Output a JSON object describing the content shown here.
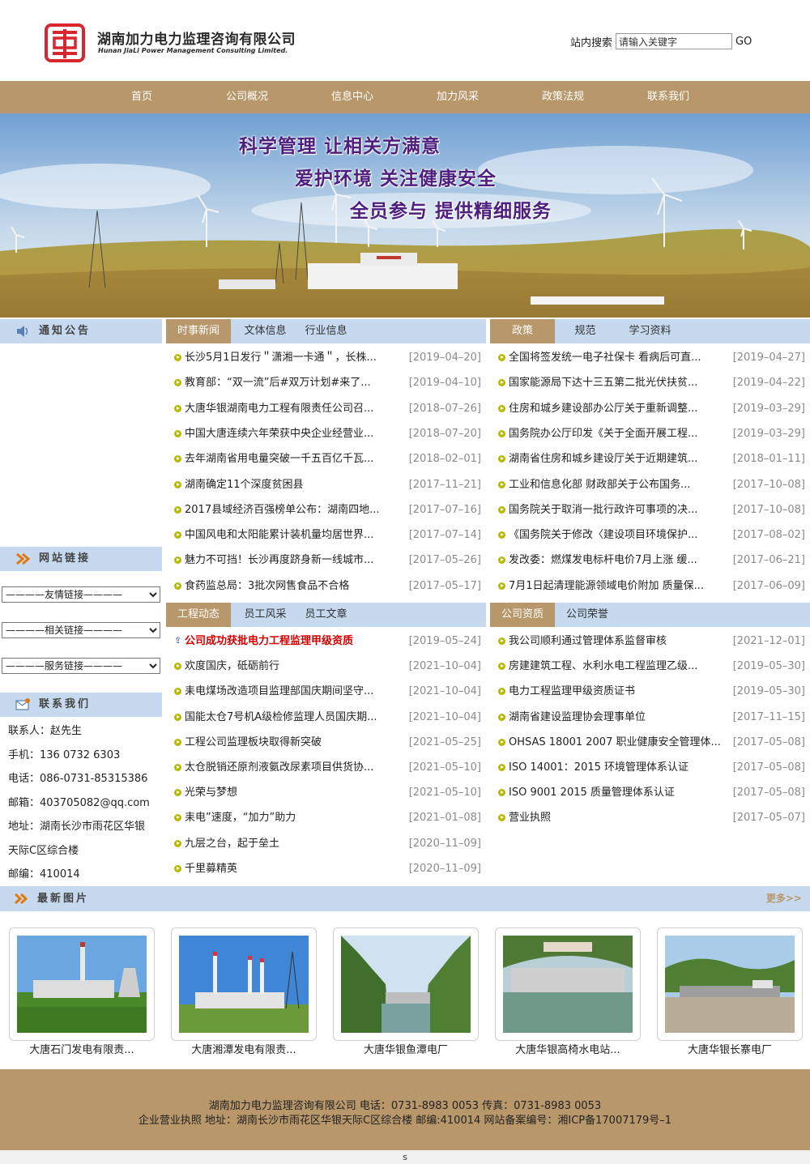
{
  "header": {
    "logo_cn": "湖南加力电力监理咨询有限公司",
    "logo_en": "Hunan JiaLi Power Management Consulting Limited.",
    "search_label": "站内搜索",
    "search_placeholder": "请输入关键字",
    "search_button": "GO"
  },
  "nav": [
    "首页",
    "公司概况",
    "信息中心",
    "加力风采",
    "政策法规",
    "联系我们"
  ],
  "banner": {
    "slogan1": "科学管理  让相关方满意",
    "slogan2": "爱护环境  关注健康安全",
    "slogan3": "全员参与  提供精细服务"
  },
  "sidebar": {
    "notice_title": "通知公告",
    "links_title": "网站链接",
    "select_friend": "————友情链接————",
    "select_related": "————相关链接————",
    "select_service": "————服务链接————",
    "contact_title": "联系我们",
    "contact": [
      "联系人：赵先生",
      "手机：136 0732 6303",
      "电话：086-0731-85315386",
      "邮箱：403705082@qq.com",
      "地址：湖南长沙市雨花区华银",
      "天际C区综合楼",
      "邮编：410014"
    ]
  },
  "news": {
    "tabs": [
      "时事新闻",
      "文体信息",
      "行业信息"
    ],
    "items": [
      {
        "title": "长沙5月1日发行＂潇湘一卡通＂，长株...",
        "date": "[2019–04–20]"
      },
      {
        "title": "教育部：“双一流”后#双万计划#来了...",
        "date": "[2019–04–10]"
      },
      {
        "title": "大唐华银湖南电力工程有限责任公司召...",
        "date": "[2018–07–26]"
      },
      {
        "title": "中国大唐连续六年荣获中央企业经营业...",
        "date": "[2018–07–20]"
      },
      {
        "title": "去年湖南省用电量突破一千五百亿千瓦...",
        "date": "[2018–02–01]"
      },
      {
        "title": "湖南确定11个深度贫困县",
        "date": "[2017–11–21]"
      },
      {
        "title": "2017县域经济百强榜单公布：湖南四地...",
        "date": "[2017–07–16]"
      },
      {
        "title": "中国风电和太阳能累计装机量均居世界...",
        "date": "[2017–07–14]"
      },
      {
        "title": "魅力不可挡！长沙再度跻身新一线城市...",
        "date": "[2017–05–26]"
      },
      {
        "title": "食药监总局：3批次网售食品不合格",
        "date": "[2017–05–17]"
      }
    ]
  },
  "policy": {
    "tabs": [
      "政策",
      "规范",
      "学习资料"
    ],
    "items": [
      {
        "title": "全国将签发统一电子社保卡 看病后可直...",
        "date": "[2019–04–27]"
      },
      {
        "title": "国家能源局下达十三五第二批光伏扶贫...",
        "date": "[2019–04–22]"
      },
      {
        "title": "住房和城乡建设部办公厅关于重新调整...",
        "date": "[2019–03–29]"
      },
      {
        "title": "国务院办公厅印发《关于全面开展工程...",
        "date": "[2019–03–29]"
      },
      {
        "title": "湖南省住房和城乡建设厅关于近期建筑...",
        "date": "[2018–01–11]"
      },
      {
        "title": "工业和信息化部  财政部关于公布国务...",
        "date": "[2017–10–08]"
      },
      {
        "title": "国务院关于取消一批行政许可事项的决...",
        "date": "[2017–10–08]"
      },
      {
        "title": "《国务院关于修改〈建设项目环境保护...",
        "date": "[2017–08–02]"
      },
      {
        "title": "发改委：燃煤发电标杆电价7月上涨 缓...",
        "date": "[2017–06–21]"
      },
      {
        "title": "7月1日起清理能源领域电价附加 质量保...",
        "date": "[2017–06–09]"
      }
    ]
  },
  "projects": {
    "tabs": [
      "工程动态",
      "员工风采",
      "员工文章"
    ],
    "items": [
      {
        "title": "公司成功获批电力工程监理甲级资质",
        "date": "[2019–05–24]"
      },
      {
        "title": "欢度国庆，砥砺前行",
        "date": "[2021–10–04]"
      },
      {
        "title": "耒电煤场改造项目监理部国庆期间坚守...",
        "date": "[2021–10–04]"
      },
      {
        "title": "国能太仓7号机A级检修监理人员国庆期...",
        "date": "[2021–10–04]"
      },
      {
        "title": "工程公司监理板块取得新突破",
        "date": "[2021–05–25]"
      },
      {
        "title": "太仓脱销还原剂液氨改尿素项目供货协...",
        "date": "[2021–05–10]"
      },
      {
        "title": "光荣与梦想",
        "date": "[2021–05–10]"
      },
      {
        "title": "耒电”速度，“加力”助力",
        "date": "[2021–01–08]"
      },
      {
        "title": "九层之台，起于垒土",
        "date": "[2020–11–09]"
      },
      {
        "title": "千里募精英",
        "date": "[2020–11–09]"
      }
    ]
  },
  "qualifications": {
    "tabs": [
      "公司资质",
      "公司荣誉"
    ],
    "items": [
      {
        "title": "我公司顺利通过管理体系监督审核",
        "date": "[2021–12–01]"
      },
      {
        "title": "房建建筑工程、水利水电工程监理乙级...",
        "date": "[2019–05–30]"
      },
      {
        "title": "电力工程监理甲级资质证书",
        "date": "[2019–05–30]"
      },
      {
        "title": "湖南省建设监理协会理事单位",
        "date": "[2017–11–15]"
      },
      {
        "title": "OHSAS 18001 2007 职业健康安全管理体...",
        "date": "[2017–05–08]"
      },
      {
        "title": "ISO 14001：2015 环境管理体系认证",
        "date": "[2017–05–08]"
      },
      {
        "title": "ISO 9001 2015 质量管理体系认证",
        "date": "[2017–05–08]"
      },
      {
        "title": "营业执照",
        "date": "[2017–05–07]"
      }
    ]
  },
  "photos": {
    "title": "最新图片",
    "more": "更多>>",
    "items": [
      "大唐石门发电有限责...",
      "大唐湘潭发电有限责...",
      "大唐华银鱼潭电厂",
      "大唐华银高椅水电站...",
      "大唐华银长寨电厂"
    ]
  },
  "footer": {
    "line1": "湖南加力电力监理咨询有限公司 电话：0731-8983 0053 传真：0731-8983 0053",
    "line2": "企业营业执照 地址：湖南长沙市雨花区华银天际C区综合楼 邮编:410014 网站备案编号：湘ICP备17007179号–1",
    "bottom": "s"
  },
  "colors": {
    "nav_bg": "#b8976a",
    "section_head_bg": "#c6d9ef",
    "slogan": "#4e1f7e",
    "logo_red": "#d7262d",
    "headline_red": "#d40000"
  }
}
